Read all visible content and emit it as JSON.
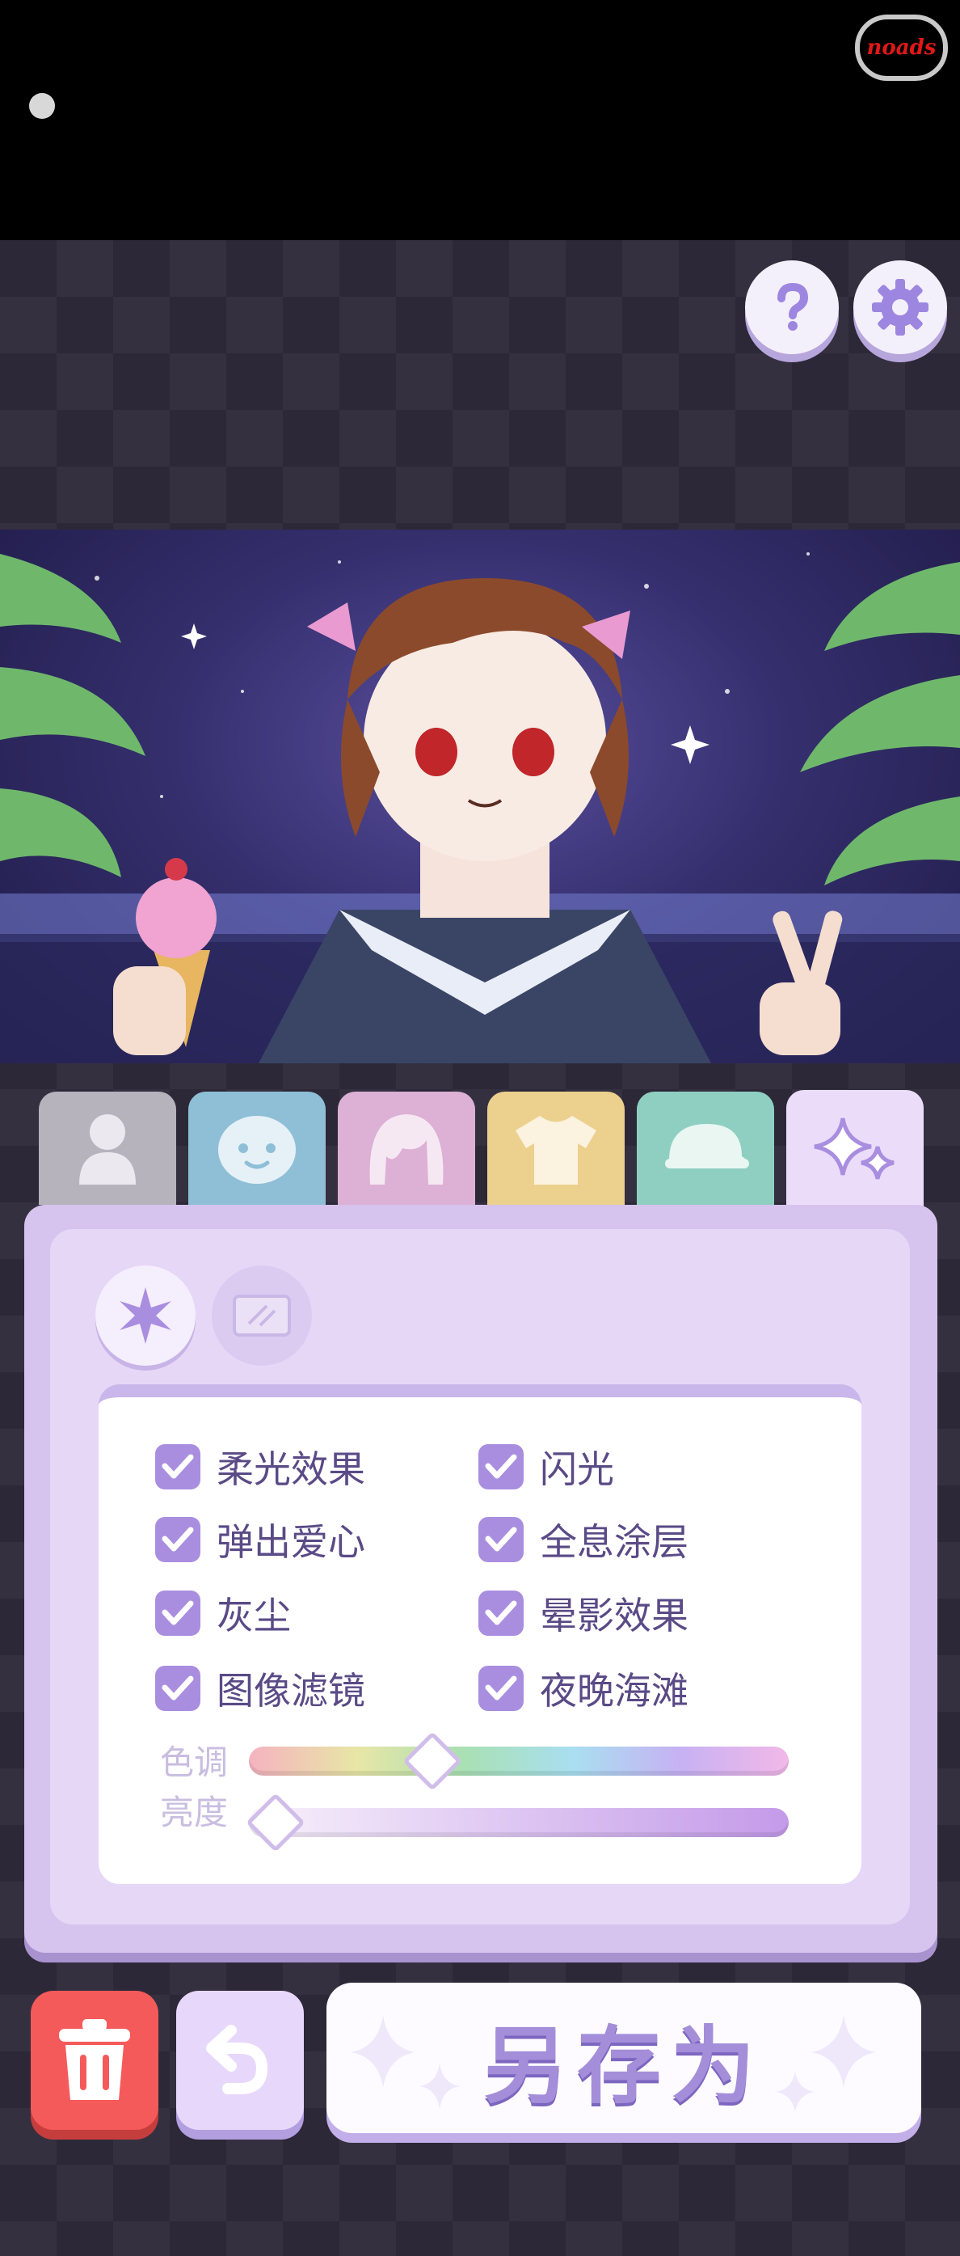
{
  "top_bar": {
    "noads_label": "noads"
  },
  "header_buttons": {
    "help_icon": "question-icon",
    "settings_icon": "gear-icon"
  },
  "tabs": [
    {
      "id": "body",
      "icon": "body-silhouette-icon",
      "color": "#b7b3bd"
    },
    {
      "id": "face",
      "icon": "face-icon",
      "color": "#8fbfd6"
    },
    {
      "id": "hair",
      "icon": "hair-icon",
      "color": "#ddb0d5"
    },
    {
      "id": "clothes",
      "icon": "shirt-icon",
      "color": "#ecd08e"
    },
    {
      "id": "hat",
      "icon": "cap-icon",
      "color": "#8fcfc1"
    },
    {
      "id": "effects",
      "icon": "sparkles-icon",
      "color": "#ebddfa",
      "selected": true
    }
  ],
  "subtabs": [
    {
      "id": "sparkle",
      "icon": "sparkle-icon",
      "selected": true
    },
    {
      "id": "frame",
      "icon": "frame-icon",
      "selected": false
    }
  ],
  "effects": {
    "options": [
      {
        "label": "柔光效果",
        "checked": true
      },
      {
        "label": "闪光",
        "checked": true
      },
      {
        "label": "弹出爱心",
        "checked": true
      },
      {
        "label": "全息涂层",
        "checked": true
      },
      {
        "label": "灰尘",
        "checked": true
      },
      {
        "label": "晕影效果",
        "checked": true
      },
      {
        "label": "图像滤镜",
        "checked": true
      },
      {
        "label": "夜晚海滩",
        "checked": true
      }
    ],
    "hue_label": "色调",
    "hue_value": 0.34,
    "brightness_label": "亮度",
    "brightness_value": 0.05
  },
  "actions": {
    "delete_icon": "trash-icon",
    "undo_icon": "undo-icon",
    "save_as_label": "另存为"
  },
  "colors": {
    "accent": "#a98ee0",
    "panel": "#d6c3ee",
    "text": "#5a4a86",
    "delete": "#f55a5a"
  }
}
